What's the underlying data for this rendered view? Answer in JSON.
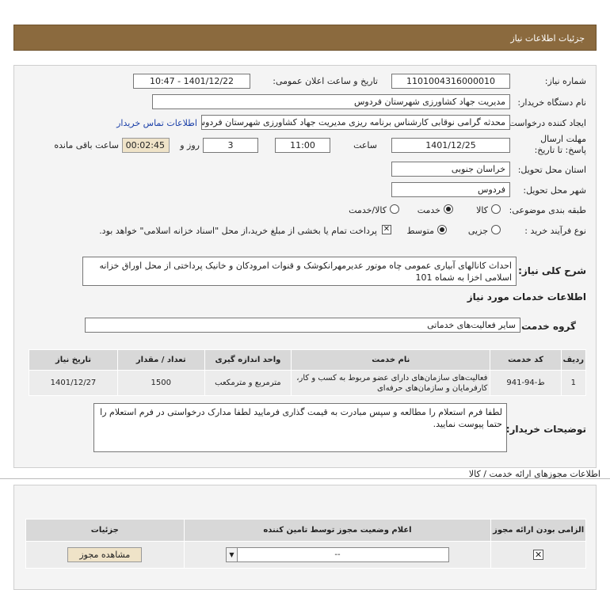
{
  "header": {
    "title": "جزئیات اطلاعات نیاز"
  },
  "form": {
    "need_number_label": "شماره نیاز:",
    "need_number": "1101004316000010",
    "announce_label": "تاریخ و ساعت اعلان عمومی:",
    "announce_value": "1401/12/22 - 10:47",
    "buyer_org_label": "نام دستگاه خریدار:",
    "buyer_org": "مدیریت جهاد کشاورزی شهرستان فردوس",
    "requester_label": "ایجاد کننده درخواست:",
    "requester": "محدثه گرامی نوقابی کارشناس برنامه ریزی مدیریت جهاد کشاورزی شهرستان فردوس",
    "contact_link": "اطلاعات تماس خریدار",
    "deadline_label": "مهلت ارسال پاسخ: تا تاریخ:",
    "deadline_date": "1401/12/25",
    "time_label": "ساعت",
    "deadline_time": "11:00",
    "day_label": "روز و",
    "days": "3",
    "remaining_time": "00:02:45",
    "remaining_label": "ساعت باقی مانده",
    "province_label": "استان محل تحویل:",
    "province": "خراسان جنوبی",
    "city_label": "شهر محل تحویل:",
    "city": "فردوس",
    "category_label": "طبقه بندی موضوعی:",
    "category_options": [
      "کالا",
      "خدمت",
      "کالا/خدمت"
    ],
    "category_selected": "خدمت",
    "process_label": "نوع فرآیند خرید :",
    "process_options": [
      "جزیی",
      "متوسط"
    ],
    "process_selected": "متوسط",
    "payment_note": "پرداخت تمام یا بخشی از مبلغ خرید،از محل \"اسناد خزانه اسلامی\" خواهد بود.",
    "general_desc_label": "شرح کلی نیاز:",
    "general_desc": "احداث کانالهای آبیاری عمومی چاه موتور عدیرمهرانکوشک و قنوات امرودکان و خانیک پرداختی از محل اوراق خزانه اسلامی اخزا به شماه 101",
    "services_section": "اطلاعات خدمات مورد نیاز",
    "service_group_label": "گروه خدمت:",
    "service_group": "سایر فعالیت‌های خدماتی",
    "buyer_notes_label": "توضیحات خریدار:",
    "buyer_notes": "لطفا فرم استعلام را مطالعه و سپس مبادرت به قیمت گذاری فرمایید لطفا مدارک درخواستی در فرم استعلام را حتما پیوست نمایید."
  },
  "items_table": {
    "headers": [
      "ردیف",
      "کد خدمت",
      "نام خدمت",
      "واحد اندازه گیری",
      "تعداد / مقدار",
      "تاریخ نیاز"
    ],
    "rows": [
      [
        "1",
        "ط-94-941",
        "فعالیت‌های سازمان‌های دارای عضو مربوط به کسب و کار، کارفرمایان و سازمان‌های حرفه‌ای",
        "مترمربع و مترمکعب",
        "1500",
        "1401/12/27"
      ]
    ]
  },
  "licenses": {
    "title": "اطلاعات مجوزهای ارائه خدمت / کالا",
    "headers": [
      "الزامی بودن ارائه مجوز",
      "اعلام وضعیت مجوز توسط تامین کننده",
      "جزئیات"
    ],
    "select_value": "--",
    "view_button": "مشاهده مجوز"
  }
}
